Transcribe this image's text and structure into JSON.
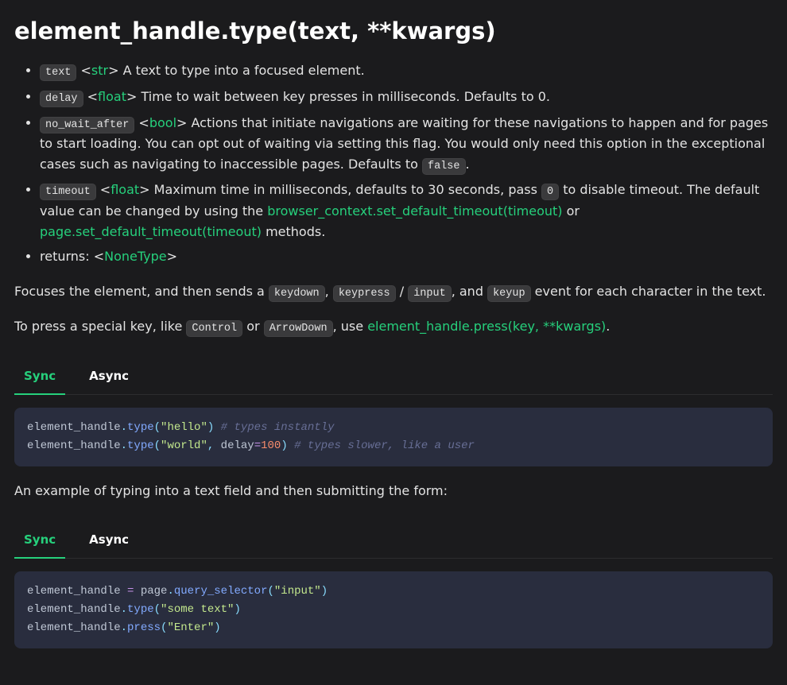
{
  "heading": "element_handle.type(text, **kwargs)",
  "params": {
    "text": {
      "name": "text",
      "type": "str",
      "desc_after": "> A text to type into a focused element."
    },
    "delay": {
      "name": "delay",
      "type": "float",
      "desc_after": "> Time to wait between key presses in milliseconds. Defaults to 0."
    },
    "no_wait_after": {
      "name": "no_wait_after",
      "type": "bool",
      "desc_after_1": "> Actions that initiate navigations are waiting for these navigations to happen and for pages to start loading. You can opt out of waiting via setting this flag. You would only need this option in the exceptional cases such as navigating to inaccessible pages. Defaults to ",
      "false_code": "false",
      "desc_after_2": "."
    },
    "timeout": {
      "name": "timeout",
      "type": "float",
      "desc_after_1": "> Maximum time in milliseconds, defaults to 30 seconds, pass ",
      "zero_code": "0",
      "desc_after_2": " to disable timeout. The default value can be changed by using the ",
      "link1": "browser_context.set_default_timeout(timeout)",
      "or": " or ",
      "link2": "page.set_default_timeout(timeout)",
      "tail": " methods."
    },
    "returns": {
      "label": "returns: <",
      "type": "NoneType",
      "tail": ">"
    }
  },
  "desc1": {
    "pre": "Focuses the element, and then sends a ",
    "kd": "keydown",
    "sep1": ", ",
    "kp": "keypress",
    "slash": " / ",
    "inp": "input",
    "sep2": ", and ",
    "ku": "keyup",
    "tail": " event for each character in the text."
  },
  "desc2": {
    "pre": "To press a special key, like ",
    "ctrl": "Control",
    "or": " or ",
    "arrow": "ArrowDown",
    "use": ", use ",
    "link": "element_handle.press(key, **kwargs)",
    "tail": "."
  },
  "tabs": {
    "sync": "Sync",
    "async": "Async"
  },
  "code1": {
    "l1": {
      "a": "element_handle",
      "dot": ".",
      "fn": "type",
      "op": "(",
      "str": "\"hello\"",
      "cp": ")",
      "sp": " ",
      "cm": "# types instantly"
    },
    "l2": {
      "a": "element_handle",
      "dot": ".",
      "fn": "type",
      "op": "(",
      "str": "\"world\"",
      "comma": ",",
      "sp1": " ",
      "arg": "delay",
      "eq": "=",
      "num": "100",
      "cp": ")",
      "sp2": " ",
      "cm": "# types slower, like a user"
    }
  },
  "midpara": "An example of typing into a text field and then submitting the form:",
  "code2": {
    "l1": {
      "a": "element_handle ",
      "eq": "=",
      "b": " page",
      "dot": ".",
      "fn": "query_selector",
      "op": "(",
      "str": "\"input\"",
      "cp": ")"
    },
    "l2": {
      "a": "element_handle",
      "dot": ".",
      "fn": "type",
      "op": "(",
      "str": "\"some text\"",
      "cp": ")"
    },
    "l3": {
      "a": "element_handle",
      "dot": ".",
      "fn": "press",
      "op": "(",
      "str": "\"Enter\"",
      "cp": ")"
    }
  }
}
